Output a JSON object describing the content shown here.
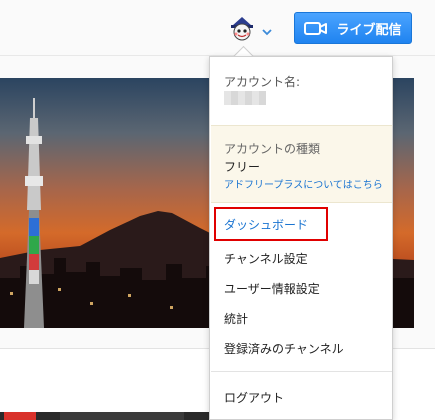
{
  "header": {
    "live_button_label": "ライブ配信"
  },
  "menu": {
    "account_name_label": "アカウント名:",
    "account_name_value": "••••••",
    "account_type_label": "アカウントの種類",
    "account_type_value": "フリー",
    "adfree_link": "アドフリープラスについてはこちら",
    "items": [
      {
        "label": "ダッシュボード",
        "highlighted": true
      },
      {
        "label": "チャンネル設定",
        "highlighted": false
      },
      {
        "label": "ユーザー情報設定",
        "highlighted": false
      },
      {
        "label": "統計",
        "highlighted": false
      },
      {
        "label": "登録済みのチャンネル",
        "highlighted": false
      }
    ],
    "logout_label": "ログアウト"
  },
  "colors": {
    "live_button": "#1f83f0",
    "dashboard_link": "#1a74d1",
    "highlight_border": "#e00000",
    "account_box_bg": "#fbf7ea"
  },
  "icons": {
    "avatar": "avatar-icon",
    "chevron": "chevron-down-icon",
    "camera": "video-camera-icon"
  }
}
